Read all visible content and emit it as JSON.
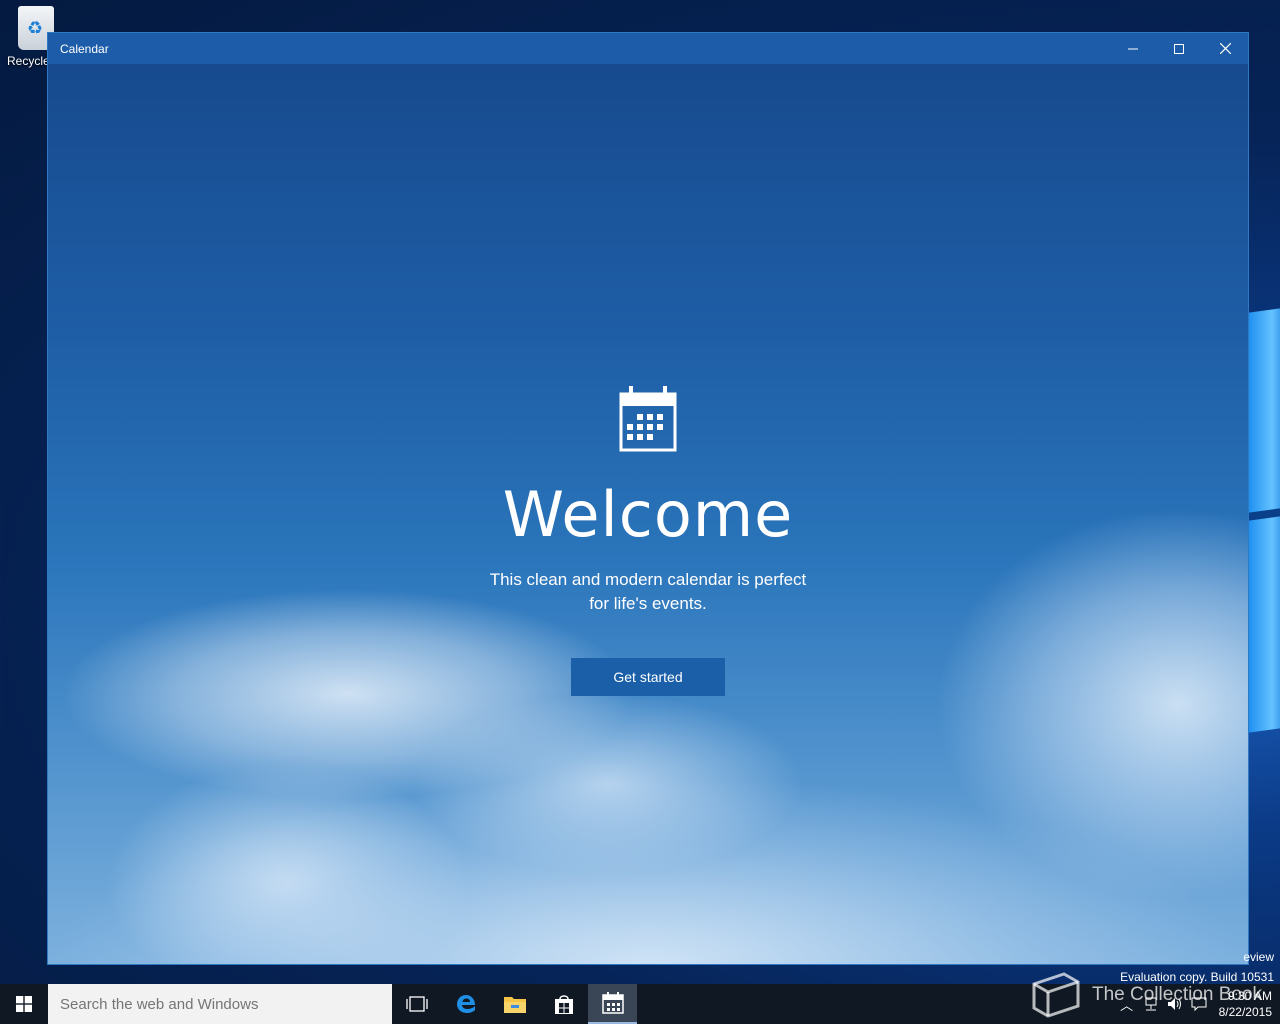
{
  "desktop": {
    "recycle_bin_label": "Recycle",
    "watermark_line1": "eview",
    "watermark_line2": "Evaluation copy. Build 10531",
    "brand_text": "The Collection Book"
  },
  "window": {
    "title": "Calendar",
    "controls": {
      "minimize_icon": "minimize-icon",
      "maximize_icon": "maximize-icon",
      "close_icon": "close-icon"
    }
  },
  "welcome": {
    "icon": "calendar-icon",
    "heading": "Welcome",
    "subtitle_line1": "This clean and modern calendar is perfect",
    "subtitle_line2": "for life's events.",
    "button_label": "Get started"
  },
  "taskbar": {
    "search_placeholder": "Search the web and Windows",
    "icons": [
      "start-icon",
      "task-view-icon",
      "edge-icon",
      "file-explorer-icon",
      "store-icon",
      "calendar-icon"
    ],
    "clock_time": "9:30 AM",
    "clock_date": "8/22/2015"
  },
  "colors": {
    "title_bar": "#1c5ca8",
    "button": "#1a5fa8",
    "taskbar": "#101823"
  }
}
